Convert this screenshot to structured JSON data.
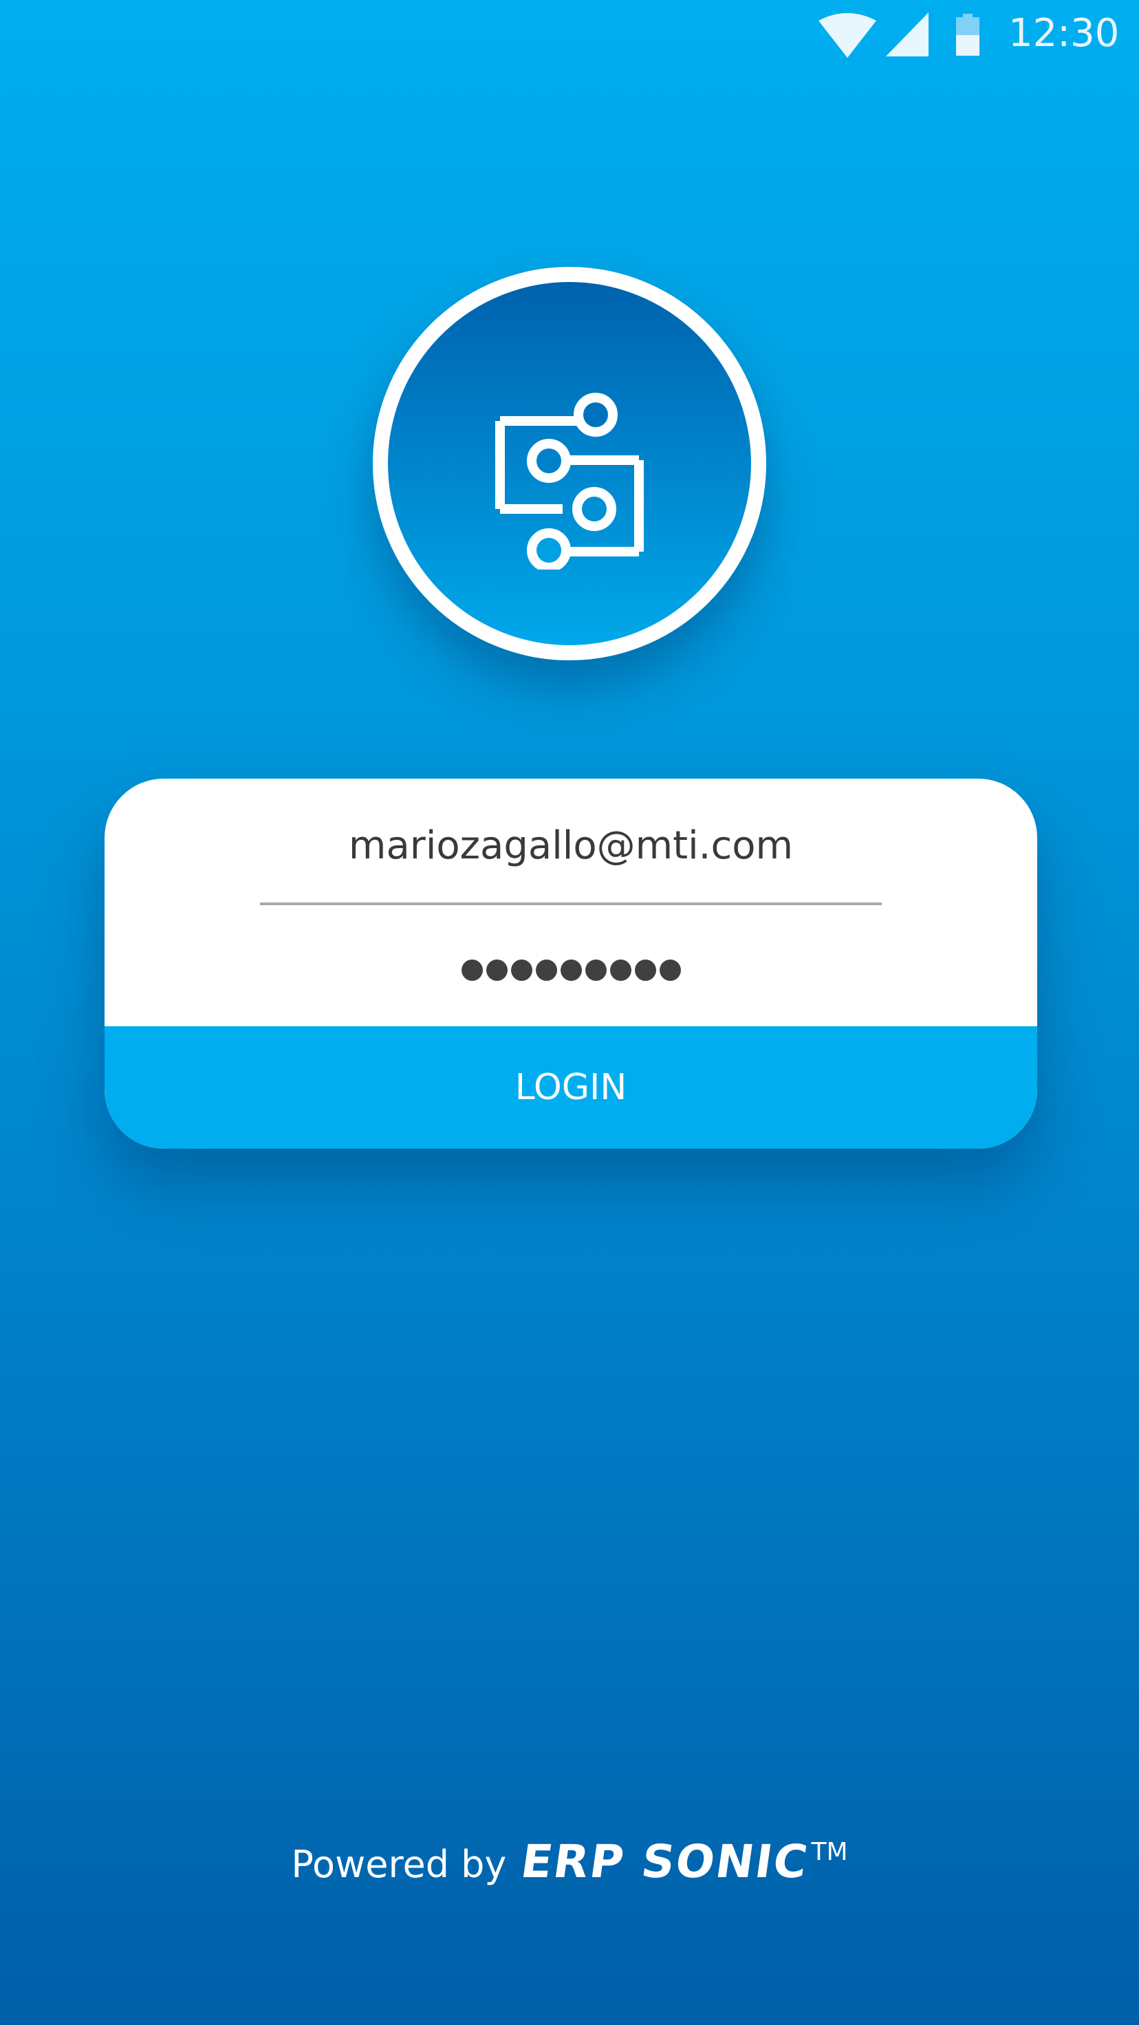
{
  "status_bar": {
    "time": "12:30",
    "icons": [
      "wifi-icon",
      "cellular-signal-icon",
      "battery-icon"
    ]
  },
  "logo": {
    "icon": "network-nodes-icon"
  },
  "login": {
    "email_value": "mariozagallo@mti.com",
    "password_masked": "●●●●●●●●●",
    "button_label": "LOGIN"
  },
  "footer": {
    "powered_by": "Powered by",
    "brand": "ERP SONIC",
    "trademark": "TM"
  },
  "colors": {
    "background_top": "#00aef0",
    "background_bottom": "#005fa8",
    "button": "#00aeef",
    "card": "#ffffff",
    "text_dark": "#3a3a3a"
  }
}
